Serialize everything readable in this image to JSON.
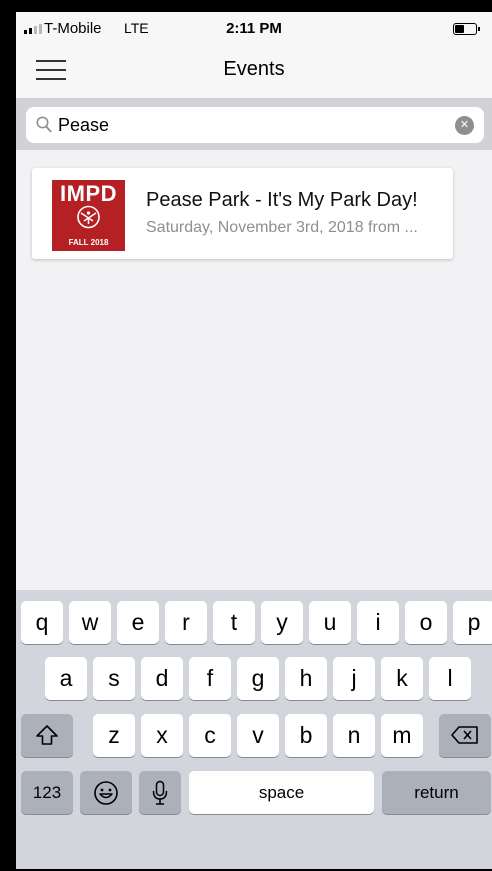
{
  "status_bar": {
    "carrier": "T-Mobile",
    "network": "LTE",
    "time": "2:11 PM"
  },
  "nav": {
    "title": "Events",
    "menu_icon": "hamburger-menu-icon"
  },
  "search": {
    "value": "Pease",
    "icon": "search-icon",
    "clear_icon": "clear-icon"
  },
  "results": [
    {
      "title": "Pease Park - It's My Park Day!",
      "date": "Saturday, November 3rd, 2018 from ...",
      "thumb": {
        "heading": "IMPD",
        "subheading": "FALL 2018",
        "color": "#b52025"
      }
    }
  ],
  "keyboard": {
    "row1": [
      "q",
      "w",
      "e",
      "r",
      "t",
      "y",
      "u",
      "i",
      "o",
      "p"
    ],
    "row2": [
      "a",
      "s",
      "d",
      "f",
      "g",
      "h",
      "j",
      "k",
      "l"
    ],
    "row3": [
      "z",
      "x",
      "c",
      "v",
      "b",
      "n",
      "m"
    ],
    "numbers_label": "123",
    "space_label": "space",
    "return_label": "return",
    "shift_icon": "shift-icon",
    "delete_icon": "backspace-icon",
    "emoji_icon": "emoji-icon",
    "mic_icon": "microphone-icon"
  }
}
